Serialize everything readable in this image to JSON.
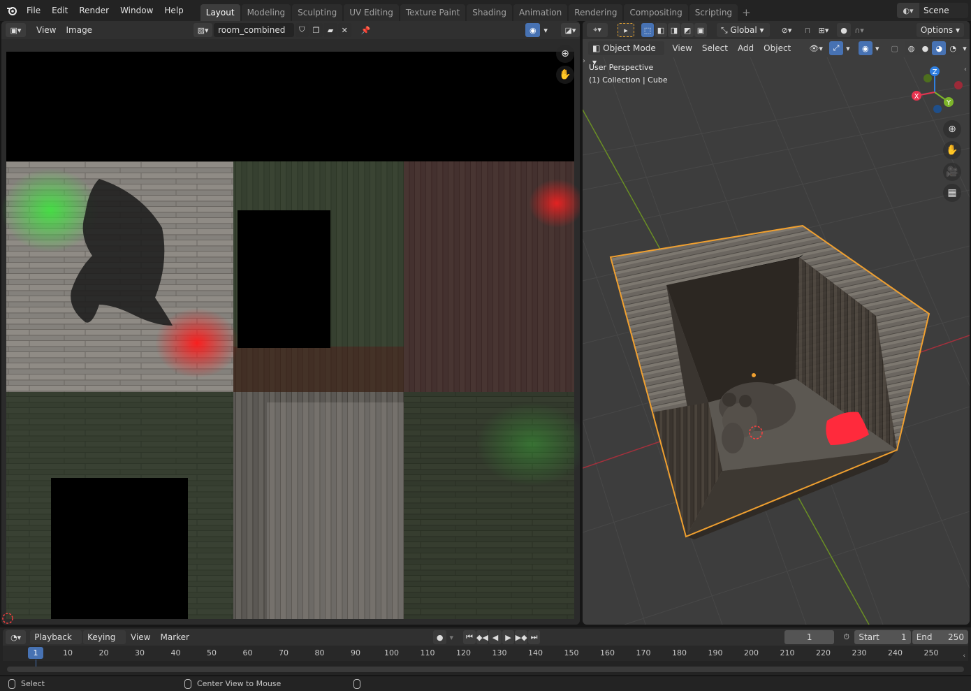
{
  "topbar": {
    "menu": [
      "File",
      "Edit",
      "Render",
      "Window",
      "Help"
    ],
    "workspaces": [
      "Layout",
      "Modeling",
      "Sculpting",
      "UV Editing",
      "Texture Paint",
      "Shading",
      "Animation",
      "Rendering",
      "Compositing",
      "Scripting"
    ],
    "active_workspace": "Layout",
    "add_workspace": "+",
    "scene_name": "Scene"
  },
  "image_editor": {
    "view_menu": "View",
    "image_menu": "Image",
    "image_name": "room_combined"
  },
  "viewport": {
    "transform_orientation": "Global",
    "options_label": "Options",
    "mode": "Object Mode",
    "menus": [
      "View",
      "Select",
      "Add",
      "Object"
    ],
    "overlay_line1": "User Perspective",
    "overlay_line2": "(1) Collection | Cube",
    "gizmo_axes": {
      "x": "X",
      "y": "Y",
      "z": "Z"
    }
  },
  "timeline": {
    "menus": [
      "Playback",
      "Keying",
      "View",
      "Marker"
    ],
    "current_frame": "1",
    "start_label": "Start",
    "start_value": "1",
    "end_label": "End",
    "end_value": "250",
    "ruler_labels": [
      "1",
      "10",
      "20",
      "30",
      "40",
      "50",
      "60",
      "70",
      "80",
      "90",
      "100",
      "110",
      "120",
      "130",
      "140",
      "150",
      "160",
      "170",
      "180",
      "190",
      "200",
      "210",
      "220",
      "230",
      "240",
      "250"
    ],
    "current_frame_ruler": "1"
  },
  "statusbar": {
    "select": "Select",
    "center_view": "Center View to Mouse"
  },
  "colors": {
    "accent": "#4772b3",
    "selection_outline": "#f0a030",
    "axis_x": "#e8334f",
    "axis_y": "#7db52a",
    "axis_z": "#2f7fe0"
  }
}
